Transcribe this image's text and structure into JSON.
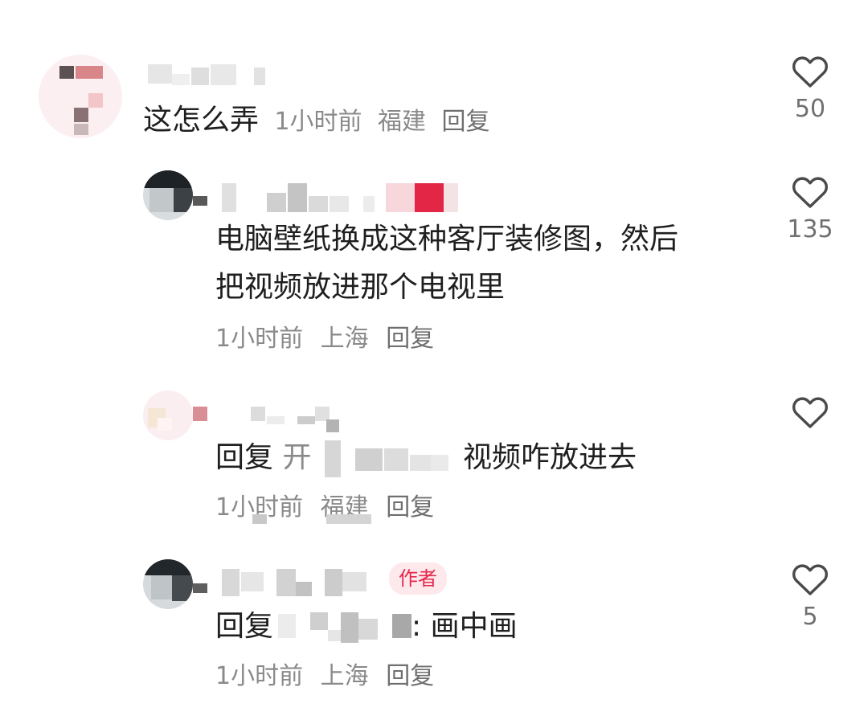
{
  "comments": [
    {
      "text": "这怎么弄",
      "time": "1小时前",
      "location": "福建",
      "reply": "回复",
      "likes": "50"
    },
    {
      "text_line1": "电脑壁纸换成这种客厅装修图，然后",
      "text_line2": "把视频放进那个电视里",
      "time": "1小时前",
      "location": "上海",
      "reply": "回复",
      "likes": "135"
    },
    {
      "reply_prefix": "回复",
      "reply_to_fragment": "开",
      "text": "视频咋放进去",
      "time": "1小时前",
      "location": "福建",
      "reply": "回复"
    },
    {
      "reply_prefix": "回复",
      "text": ": 画中画",
      "badge": "作者",
      "time": "1小时前",
      "location": "上海",
      "reply": "回复",
      "likes": "5"
    }
  ],
  "colors": {
    "author_badge": "#e5284c",
    "meta_text": "#8a8a8a",
    "like_icon": "#4a4a4a"
  },
  "icons": {
    "like": "heart-outline-icon"
  }
}
